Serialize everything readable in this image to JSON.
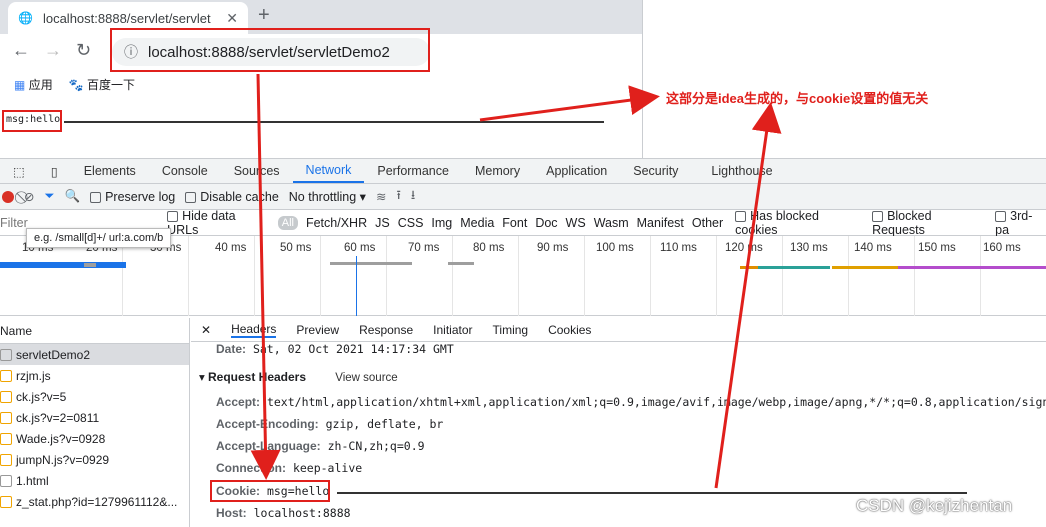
{
  "browser": {
    "tab_title": "localhost:8888/servlet/servlet",
    "url": "localhost:8888/servlet/servletDemo2",
    "bookmarks": [
      "应用",
      "百度一下"
    ]
  },
  "page": {
    "cookie_text": "msg:hello",
    "annotation": "这部分是idea生成的，与cookie设置的值无关"
  },
  "devtools": {
    "tabs": [
      "Elements",
      "Console",
      "Sources",
      "Network",
      "Performance",
      "Memory",
      "Application",
      "Security",
      "Lighthouse"
    ],
    "toolbar": {
      "preserve_log": "Preserve log",
      "disable_cache": "Disable cache",
      "throttling": "No throttling"
    },
    "filter": {
      "placeholder": "Filter",
      "hide_data_urls": "Hide data URLs",
      "all": "All",
      "types": [
        "Fetch/XHR",
        "JS",
        "CSS",
        "Img",
        "Media",
        "Font",
        "Doc",
        "WS",
        "Wasm",
        "Manifest",
        "Other"
      ],
      "blocked_cookies": "Has blocked cookies",
      "blocked_requests": "Blocked Requests",
      "third_party": "3rd-pa"
    },
    "tooltip": "e.g. /small[d]+/ url:a.com/b",
    "timeline_ticks": [
      "10 ms",
      "20 ms",
      "30 ms",
      "40 ms",
      "50 ms",
      "60 ms",
      "70 ms",
      "80 ms",
      "90 ms",
      "100 ms",
      "110 ms",
      "120 ms",
      "130 ms",
      "140 ms",
      "150 ms",
      "160 ms"
    ],
    "list_header": "Name",
    "requests": [
      "servletDemo2",
      "rzjm.js",
      "ck.js?v=5",
      "ck.js?v=2=0811",
      "Wade.js?v=0928",
      "jumpN.js?v=0929",
      "1.html",
      "z_stat.php?id=1279961112&..."
    ],
    "detail_tabs": [
      "Headers",
      "Preview",
      "Response",
      "Initiator",
      "Timing",
      "Cookies"
    ],
    "date_line": {
      "key": "Date:",
      "value": "Sat, 02 Oct 2021 14:17:34 GMT"
    },
    "request_headers_title": "Request Headers",
    "view_source": "View source",
    "headers": [
      {
        "key": "Accept:",
        "value": "text/html,application/xhtml+xml,application/xml;q=0.9,image/avif,image/webp,image/apng,*/*;q=0.8,application/signed-ex"
      },
      {
        "key": "Accept-Encoding:",
        "value": "gzip, deflate, br"
      },
      {
        "key": "Accept-Language:",
        "value": "zh-CN,zh;q=0.9"
      },
      {
        "key": "Connection:",
        "value": "keep-alive"
      },
      {
        "key": "Cookie:",
        "value": "msg=hello"
      },
      {
        "key": "Host:",
        "value": "localhost:8888"
      }
    ]
  },
  "watermark": "CSDN @kejizhentan",
  "colors": {
    "accent": "#1a73e8",
    "annotation_red": "#e0201c"
  }
}
